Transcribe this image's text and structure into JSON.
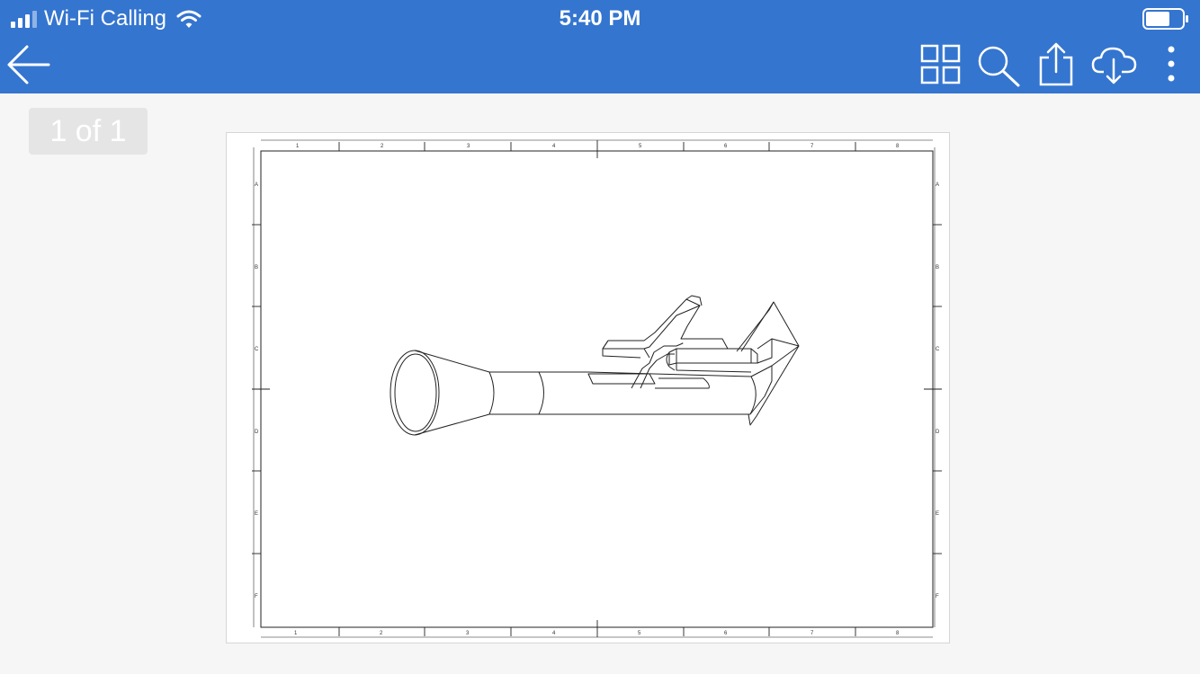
{
  "status_bar": {
    "carrier": "Wi-Fi Calling",
    "time": "5:40 PM",
    "icons": [
      "cellular-signal-icon",
      "wifi-icon",
      "battery-icon"
    ]
  },
  "toolbar": {
    "background": "#3475cf",
    "back_icon": "arrow-left-icon",
    "actions": [
      "grid-view-icon",
      "search-icon",
      "share-icon",
      "cloud-download-icon",
      "more-vertical-icon"
    ]
  },
  "viewer": {
    "page_indicator": "1 of 1"
  },
  "drawing": {
    "column_labels": [
      "1",
      "2",
      "3",
      "4",
      "5",
      "6",
      "7",
      "8"
    ],
    "row_labels": [
      "A",
      "B",
      "C",
      "D",
      "E",
      "F"
    ]
  }
}
